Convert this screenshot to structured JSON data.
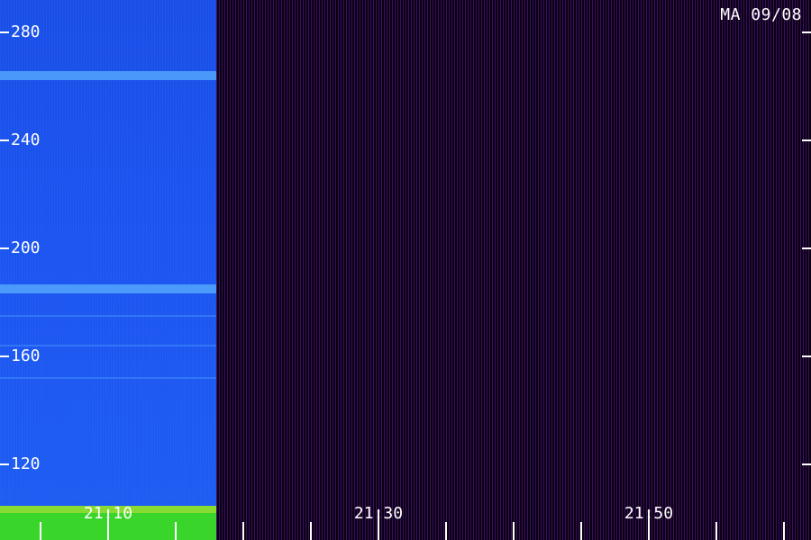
{
  "station_label": "MA 09/08",
  "chart_data": {
    "type": "heatmap",
    "title": "",
    "xlabel": "",
    "ylabel": "",
    "y_ticks": [
      120,
      160,
      200,
      240,
      280
    ],
    "y_tick_labels": [
      "120",
      "160",
      "200",
      "240",
      "280"
    ],
    "ylim": [
      106,
      292
    ],
    "x_tick_labels": [
      {
        "time": "21:10",
        "label": "21:10"
      },
      {
        "time": "21:30",
        "label": "21:30"
      },
      {
        "time": "21:50",
        "label": "21:50"
      }
    ],
    "xlim": [
      "21:02",
      "22:02"
    ],
    "data_end_time": "21:18",
    "bright_bands": [
      185,
      264
    ],
    "faint_lines": [
      152,
      164,
      175
    ],
    "colors": {
      "active_blue": "#1f4fe8",
      "band_cyan": "#5ab0ff",
      "bottom_green": "#39d52a",
      "empty_purple": "#3a1060",
      "tick": "#ffffff",
      "text": "#ffffff"
    }
  }
}
